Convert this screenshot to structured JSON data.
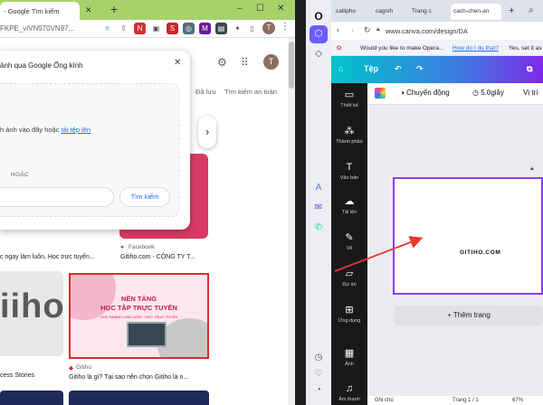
{
  "chrome": {
    "tab_title": "- Google Tìm kiếm",
    "tab_close": "✕",
    "new_tab": "+",
    "win_min": "–",
    "win_max": "☐",
    "win_close": "✕",
    "url": "FKPE_viVN970VN97...",
    "avatar_initial": "T"
  },
  "lens": {
    "title": "ảnh qua Google Ống kính",
    "drop_prefix": "h ảnh vào đây hoặc ",
    "drop_link": "tải tệp lên",
    "or_label": "HOẶC",
    "search_button": "Tìm kiếm"
  },
  "google": {
    "avatar_initial": "T",
    "tab_saved": "Đã lưu",
    "tab_safesearch": "Tìm kiếm an toàn",
    "result1_caption": "c ngay làm luôn, Học trực tuyến...",
    "result2_source": "Facebook",
    "result2_caption": "Gitiho.com - CÔNG TY T...",
    "image_giho_text": "iiho",
    "image_gitiho_heading1": "NỀN TẢNG",
    "image_gitiho_heading2": "HỌC TẬP TRỰC TUYẾN",
    "image_gitiho_sub": "HỌC NHANH LÀM LUÔN · HỌC TRỰC TUYẾN",
    "result3_caption": "cess Stories",
    "result4_source": "Gitiho",
    "result4_caption": "Gitiho là gì? Tại sao nên chọn Gitiho là n..."
  },
  "opera": {
    "tabs": [
      "callipho",
      "cagnih",
      "Trang c",
      "cach-chen-an"
    ],
    "url": "www.canva.com/design/DA",
    "prompt": "Would you like to make Opera...",
    "prompt_link": "How do I do that?",
    "prompt_yes": "Yes, set it as"
  },
  "canva": {
    "home_label": "⌂",
    "file_label": "Tệp",
    "undo": "↶",
    "redo": "↷",
    "toolbar_animate": "Chuyển động",
    "toolbar_duration": "5.0giây",
    "toolbar_position": "Vị trí",
    "side_items": [
      "Thiết kế",
      "Thành phần",
      "Văn bản",
      "Tải lên",
      "Vẽ",
      "Dự án",
      "Ứng dụng",
      "Ảnh",
      "Âm thanh"
    ],
    "page_brand": "GITIHO.COM",
    "add_page": "+ Thêm trang",
    "bottom_notes": "Ghi chú",
    "bottom_page": "Trang 1 / 1",
    "bottom_zoom": "67%"
  }
}
